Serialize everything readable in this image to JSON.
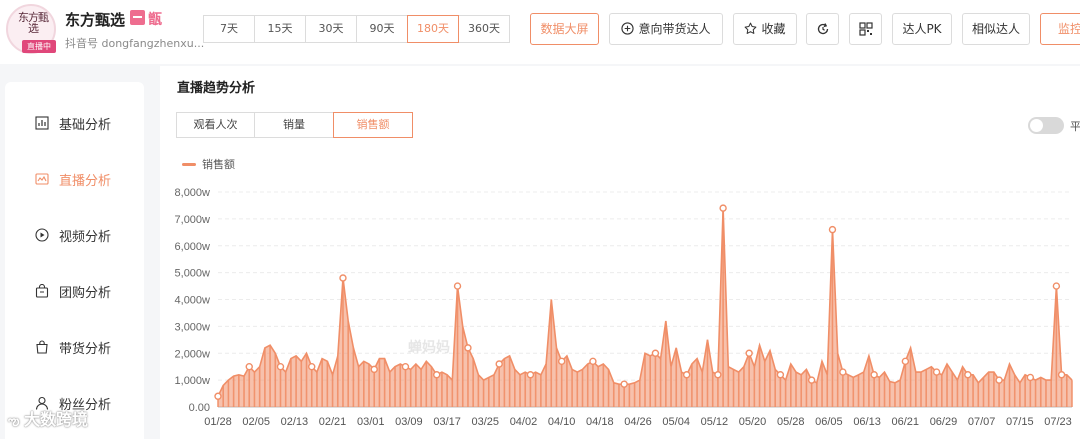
{
  "header": {
    "avatar_logo": "东方甄选",
    "live_badge": "直播中",
    "shop_name": "东方甄选",
    "shop_tag": "甑",
    "shop_id": "抖音号 dongfangzhenxu...",
    "ranges": [
      {
        "label": "7天",
        "active": false
      },
      {
        "label": "15天",
        "active": false
      },
      {
        "label": "30天",
        "active": false
      },
      {
        "label": "90天",
        "active": false
      },
      {
        "label": "180天",
        "active": true
      },
      {
        "label": "360天",
        "active": false
      }
    ],
    "data_screen_label": "数据大屏",
    "intent_label": "意向带货达人",
    "favorite_label": "收藏",
    "pk_label": "达人PK",
    "similar_label": "相似达人",
    "monitor_label": "监控",
    "accent_color": "#f08e67"
  },
  "sidebar": {
    "items": [
      {
        "label": "基础分析",
        "icon": "bar-chart-icon",
        "active": false
      },
      {
        "label": "直播分析",
        "icon": "live-icon",
        "active": true
      },
      {
        "label": "视频分析",
        "icon": "play-icon",
        "active": false
      },
      {
        "label": "团购分析",
        "icon": "bag-icon",
        "active": false
      },
      {
        "label": "带货分析",
        "icon": "shopping-bag-icon",
        "active": false
      },
      {
        "label": "粉丝分析",
        "icon": "user-icon",
        "active": false
      }
    ]
  },
  "main": {
    "title": "直播趋势分析",
    "tabs": [
      {
        "label": "观看人次",
        "active": false
      },
      {
        "label": "销量",
        "active": false
      },
      {
        "label": "销售额",
        "active": true
      }
    ],
    "toggle_label": "平",
    "chart_watermark": "蝉妈妈",
    "bottom_watermark": "大数跨境"
  },
  "chart_data": {
    "type": "area",
    "series": [
      {
        "name": "销售额",
        "color": "#f08e67"
      }
    ],
    "ylim": [
      0,
      8000
    ],
    "yticks": [
      "0.00",
      "1,000w",
      "2,000w",
      "3,000w",
      "4,000w",
      "5,000w",
      "6,000w",
      "7,000w",
      "8,000w"
    ],
    "xticks": [
      "01/28",
      "02/05",
      "02/13",
      "02/21",
      "03/01",
      "03/09",
      "03/17",
      "03/25",
      "04/02",
      "04/10",
      "04/18",
      "04/26",
      "05/04",
      "05/12",
      "05/20",
      "05/28",
      "06/05",
      "06/13",
      "06/21",
      "06/29",
      "07/07",
      "07/15",
      "07/23"
    ],
    "values": [
      400,
      800,
      1000,
      1150,
      1200,
      1150,
      1500,
      1300,
      1500,
      2200,
      2300,
      2000,
      1500,
      1300,
      1800,
      1900,
      1700,
      2000,
      1500,
      1300,
      1800,
      1700,
      1200,
      1900,
      4800,
      3200,
      2200,
      1500,
      1700,
      1600,
      1400,
      1800,
      1800,
      1300,
      1500,
      1600,
      1500,
      1400,
      1600,
      1400,
      1700,
      1500,
      1200,
      1300,
      1200,
      1000,
      4500,
      3000,
      2200,
      1800,
      1200,
      1000,
      1100,
      1200,
      1600,
      1800,
      1900,
      1400,
      1200,
      1300,
      1200,
      1300,
      1200,
      1600,
      4000,
      2200,
      1700,
      1900,
      1400,
      1300,
      1400,
      1600,
      1700,
      1500,
      1600,
      1400,
      900,
      850,
      850,
      850,
      900,
      1000,
      2000,
      1900,
      2000,
      1800,
      3200,
      1500,
      2200,
      1300,
      1200,
      1600,
      1800,
      1300,
      2500,
      1300,
      1200,
      7400,
      1500,
      1400,
      1300,
      1500,
      2000,
      1500,
      2300,
      1700,
      2100,
      1400,
      1200,
      1000,
      1600,
      1300,
      1200,
      1400,
      1000,
      900,
      1700,
      1200,
      6600,
      2000,
      1300,
      1200,
      1100,
      1200,
      1300,
      1900,
      1200,
      1100,
      1300,
      950,
      900,
      1000,
      1700,
      2200,
      1300,
      1300,
      1400,
      1500,
      1300,
      1200,
      1600,
      1300,
      1000,
      1500,
      1200,
      1200,
      900,
      1100,
      1300,
      1300,
      1000,
      1000,
      1600,
      1200,
      900,
      1200,
      1100,
      1000,
      1100,
      1000,
      1000,
      4500,
      1200,
      1200,
      1000
    ]
  }
}
